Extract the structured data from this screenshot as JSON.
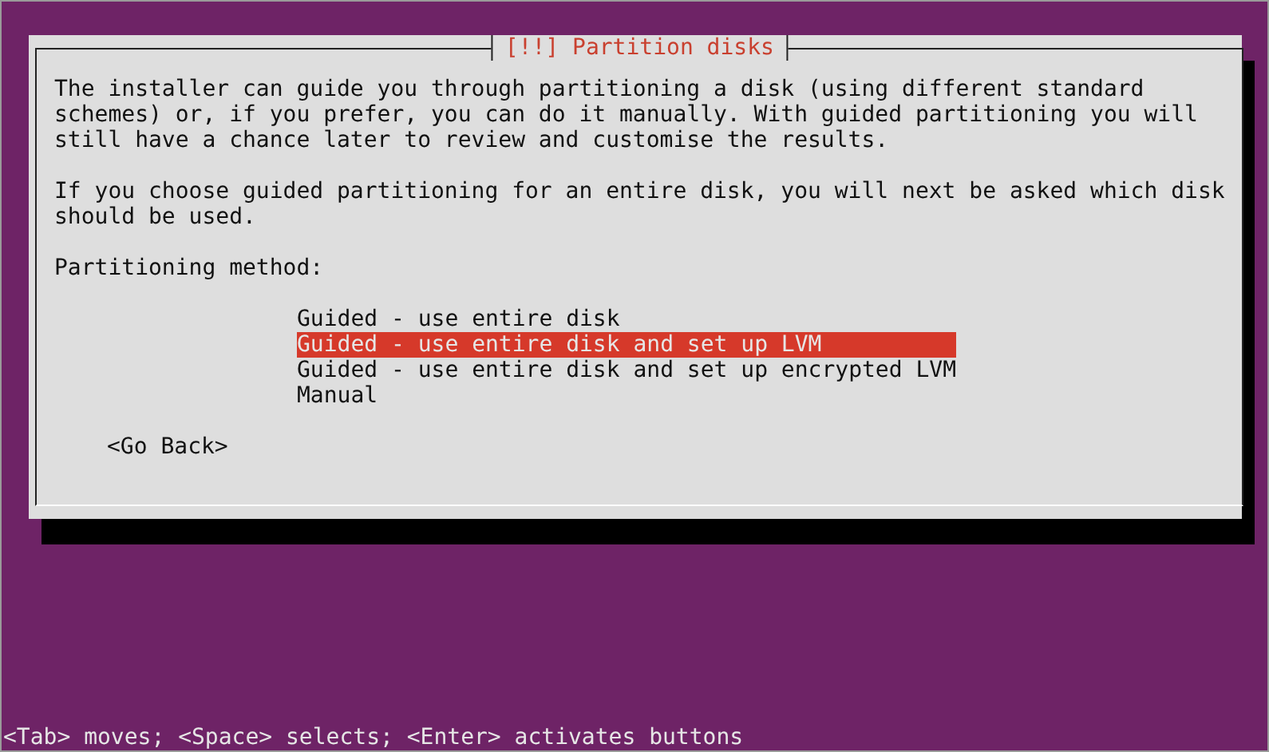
{
  "dialog": {
    "title": "[!!] Partition disks",
    "paragraphs": [
      "The installer can guide you through partitioning a disk (using different standard\nschemes) or, if you prefer, you can do it manually. With guided partitioning you will\nstill have a chance later to review and customise the results.",
      "If you choose guided partitioning for an entire disk, you will next be asked which disk\nshould be used."
    ],
    "prompt": "Partitioning method:",
    "options": [
      {
        "label": "Guided - use entire disk",
        "selected": false
      },
      {
        "label": "Guided - use entire disk and set up LVM",
        "selected": true
      },
      {
        "label": "Guided - use entire disk and set up encrypted LVM",
        "selected": false
      },
      {
        "label": "Manual",
        "selected": false
      }
    ],
    "back_button": "<Go Back>"
  },
  "status_bar": "<Tab> moves; <Space> selects; <Enter> activates buttons"
}
